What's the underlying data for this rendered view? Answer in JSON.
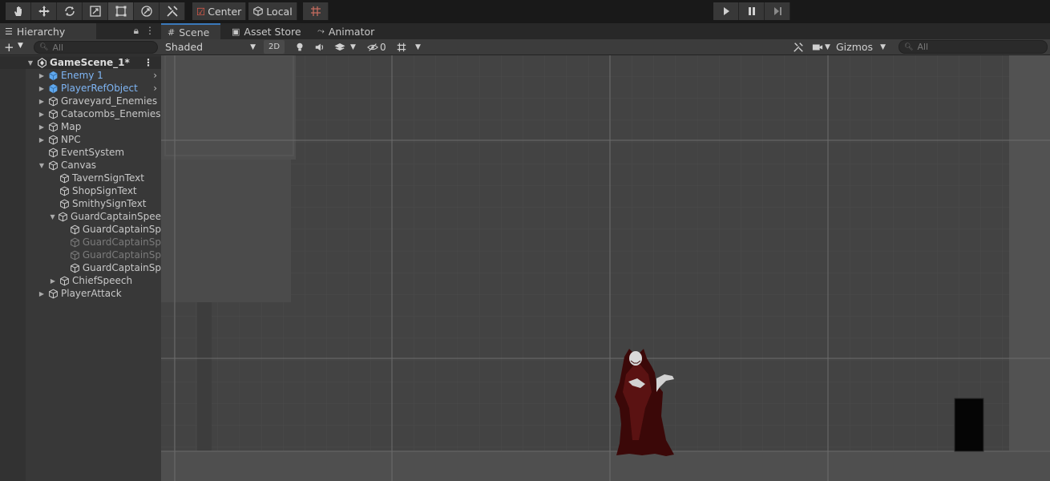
{
  "toolbar": {
    "tools": [
      "hand-tool",
      "move-tool",
      "rotate-tool",
      "scale-tool",
      "rect-tool",
      "transform-tool",
      "custom-tool"
    ],
    "pivot_label": "Center",
    "space_label": "Local"
  },
  "hierarchy": {
    "tab_label": "Hierarchy",
    "search_placeholder": "All",
    "items": [
      {
        "label": "GameScene_1*"
      },
      {
        "label": "Enemy 1"
      },
      {
        "label": "PlayerRefObject"
      },
      {
        "label": "Graveyard_Enemies"
      },
      {
        "label": "Catacombs_Enemies"
      },
      {
        "label": "Map"
      },
      {
        "label": "NPC"
      },
      {
        "label": "EventSystem"
      },
      {
        "label": "Canvas"
      },
      {
        "label": "TavernSignText"
      },
      {
        "label": "ShopSignText"
      },
      {
        "label": "SmithySignText"
      },
      {
        "label": "GuardCaptainSpee"
      },
      {
        "label": "GuardCaptainSp"
      },
      {
        "label": "GuardCaptainSp"
      },
      {
        "label": "GuardCaptainSp"
      },
      {
        "label": "GuardCaptainSp"
      },
      {
        "label": "ChiefSpeech"
      },
      {
        "label": "PlayerAttack"
      }
    ]
  },
  "scene": {
    "tabs": [
      {
        "label": "Scene"
      },
      {
        "label": "Asset Store"
      },
      {
        "label": "Animator"
      }
    ],
    "shading_mode": "Shaded",
    "mode_2d": "2D",
    "hidden_count": "0",
    "gizmos_label": "Gizmos",
    "search_placeholder": "All"
  },
  "colors": {
    "accent": "#3a79bb",
    "selected_text": "#7fb6f5",
    "viewport_bg": "#444444"
  }
}
